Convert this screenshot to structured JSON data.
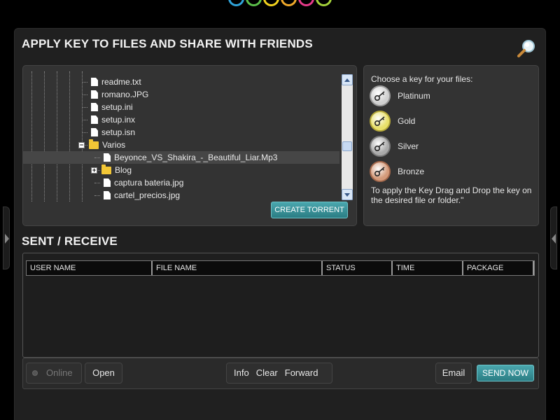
{
  "logo": {
    "colors": [
      "#2fa3d9",
      "#5bbf4a",
      "#f2d21e",
      "#f0a92a",
      "#e63a8a",
      "#a4d23a"
    ]
  },
  "colors": {
    "accent": "#3a9aa1",
    "panel": "#202020"
  },
  "apply_section": {
    "title": "APPLY KEY TO FILES AND SHARE WITH FRIENDS",
    "search_icon": "magnifier-icon"
  },
  "file_tree": {
    "items": [
      {
        "label": "readme.txt",
        "type": "file",
        "depth": 5
      },
      {
        "label": "romano.JPG",
        "type": "file",
        "depth": 5
      },
      {
        "label": "setup.ini",
        "type": "file",
        "depth": 5
      },
      {
        "label": "setup.inx",
        "type": "file",
        "depth": 5
      },
      {
        "label": "setup.isn",
        "type": "file",
        "depth": 5
      },
      {
        "label": "Varios",
        "type": "folder",
        "depth": 5,
        "expanded": true
      },
      {
        "label": "Beyonce_VS_Shakira_-_Beautiful_Liar.Mp3",
        "type": "file",
        "depth": 6,
        "selected": true
      },
      {
        "label": "Blog",
        "type": "folder",
        "depth": 6,
        "expanded": false
      },
      {
        "label": "captura bateria.jpg",
        "type": "file",
        "depth": 6
      },
      {
        "label": "cartel_precios.jpg",
        "type": "file",
        "depth": 6
      }
    ],
    "create_torrent_label": "CREATE TORRENT"
  },
  "keys": {
    "title": "Choose a key for your files:",
    "items": [
      {
        "label": "Platinum",
        "color": "#d0d0d0",
        "ring": "#9a9a9a"
      },
      {
        "label": "Gold",
        "color": "#e8e06a",
        "ring": "#b6a93a"
      },
      {
        "label": "Silver",
        "color": "#a9a9a9",
        "ring": "#7a7a7a"
      },
      {
        "label": "Bronze",
        "color": "#d39a7a",
        "ring": "#a5694c"
      }
    ],
    "help": "To apply the Key Drag and Drop the key on the desired file or folder.\""
  },
  "sent_receive": {
    "title": "SENT / RECEIVE",
    "columns": [
      "USER NAME",
      "FILE NAME",
      "STATUS",
      "TIME",
      "PACKAGE"
    ]
  },
  "toolbar": {
    "online_label": "Online",
    "open_label": "Open",
    "info_label": "Info",
    "clear_label": "Clear",
    "forward_label": "Forward",
    "email_label": "Email",
    "send_now_label": "SEND NOW"
  }
}
